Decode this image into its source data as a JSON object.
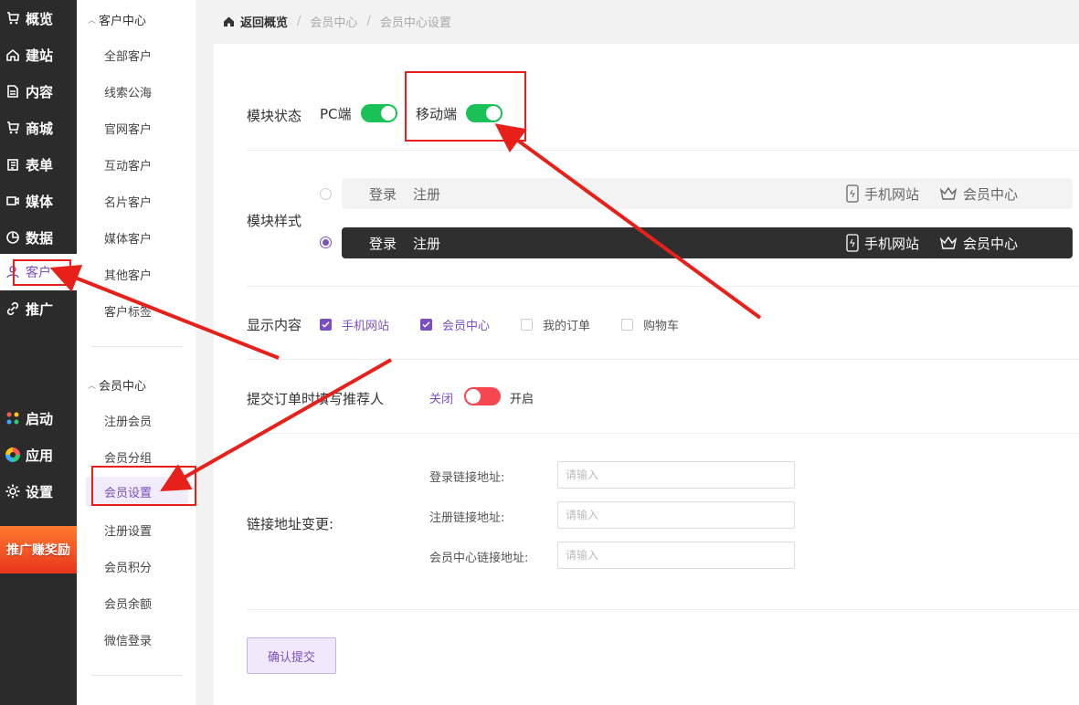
{
  "leftnav": {
    "items": [
      {
        "label": "概览",
        "icon": "cart-icon"
      },
      {
        "label": "建站",
        "icon": "home-icon"
      },
      {
        "label": "内容",
        "icon": "document-icon"
      },
      {
        "label": "商城",
        "icon": "shop-icon"
      },
      {
        "label": "表单",
        "icon": "form-icon"
      },
      {
        "label": "媒体",
        "icon": "video-icon"
      },
      {
        "label": "数据",
        "icon": "pie-icon"
      },
      {
        "label": "客户",
        "icon": "user-icon"
      },
      {
        "label": "推广",
        "icon": "link-icon"
      }
    ],
    "bottom": [
      {
        "label": "启动",
        "icon": "launch-icon"
      },
      {
        "label": "应用",
        "icon": "apps-icon"
      },
      {
        "label": "设置",
        "icon": "gear-icon"
      }
    ],
    "promo": "推广赚奖励"
  },
  "subnav": {
    "group1": "客户中心",
    "group1_items": [
      "全部客户",
      "线索公海",
      "官网客户",
      "互动客户",
      "名片客户",
      "媒体客户",
      "其他客户",
      "客户标签"
    ],
    "group2": "会员中心",
    "group2_items": [
      "注册会员",
      "会员分组",
      "会员设置",
      "注册设置",
      "会员积分",
      "会员余额",
      "微信登录"
    ]
  },
  "breadcrumb": {
    "back": "返回概览",
    "level1": "会员中心",
    "level2": "会员中心设置"
  },
  "module_status": {
    "label": "模块状态",
    "pc_label": "PC端",
    "mobile_label": "移动端"
  },
  "module_style": {
    "label": "模块样式",
    "login": "登录",
    "register": "注册",
    "mobile_site": "手机网站",
    "member_center": "会员中心"
  },
  "display_content": {
    "label": "显示内容",
    "options": [
      "手机网站",
      "会员中心",
      "我的订单",
      "购物车"
    ]
  },
  "referrer": {
    "label": "提交订单时填写推荐人",
    "off": "关闭",
    "on": "开启"
  },
  "links": {
    "label": "链接地址变更:",
    "fields": [
      "登录链接地址:",
      "注册链接地址:",
      "会员中心链接地址:"
    ],
    "placeholder": "请输入"
  },
  "submit": "确认提交",
  "colors": {
    "accent": "#7b4fc4",
    "toggle_on": "#19c157",
    "toggle_off": "#f5474f",
    "annotation": "#e8201a"
  }
}
